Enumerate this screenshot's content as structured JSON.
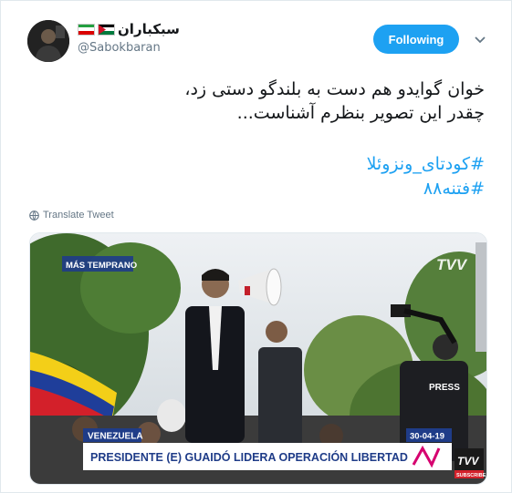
{
  "tweet": {
    "display_name": "سبکباران",
    "handle": "@Sabokbaran",
    "follow_label": "Following",
    "text_lines": [
      "خوان گوایدو هم دست به بلندگو دستی زد،",
      "چقدر این تصویر بنظرم آشناست..."
    ],
    "hashtags": [
      "#کودتای_ونزوئلا",
      "#فتنه۸۸"
    ],
    "translate_label": "Translate Tweet"
  },
  "media": {
    "tag_top": "MÁS TEMPRANO",
    "location": "VENEZUELA",
    "date": "30-04-19",
    "headline": "PRESIDENTE (E) GUAIDÓ LIDERA OPERACIÓN LIBERTAD",
    "vest_text": "PRESS",
    "subscribe": "SUBSCRIBE",
    "brand_top": "TVV",
    "brand_bottom": "TVV"
  },
  "colors": {
    "accent": "#1da1f2",
    "lower_third_blue": "#1f3c88",
    "brand_magenta": "#d6006f"
  }
}
